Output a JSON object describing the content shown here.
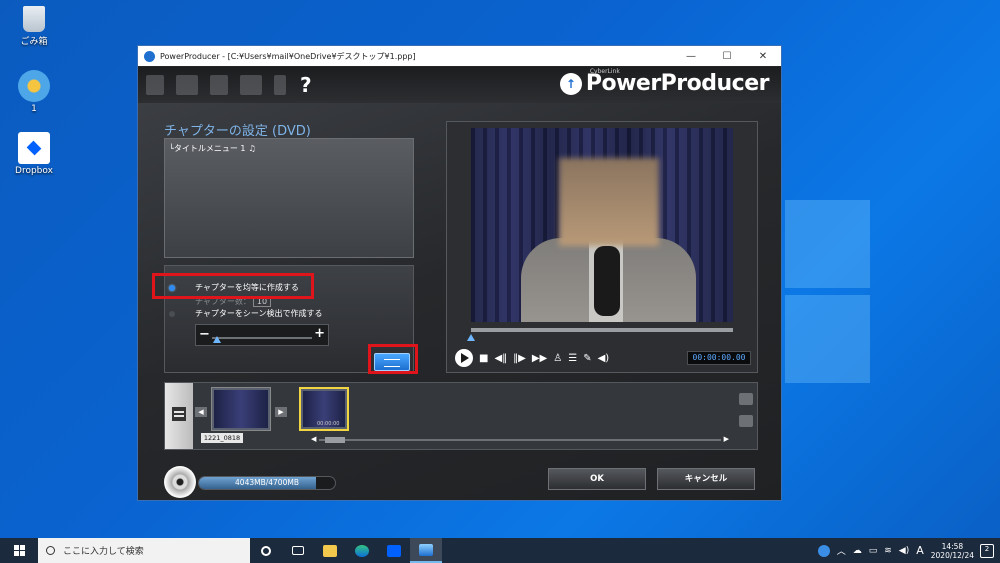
{
  "desktop": {
    "icons": [
      {
        "label": "ごみ箱",
        "icon": "recycle-bin-icon"
      },
      {
        "label": "1",
        "icon": "file-icon"
      },
      {
        "label": "Dropbox",
        "icon": "dropbox-icon"
      }
    ]
  },
  "window": {
    "title": "PowerProducer - [C:¥Users¥mail¥OneDrive¥デスクトップ¥1.ppp]",
    "controls": {
      "minimize": "—",
      "maximize": "☐",
      "close": "✕"
    }
  },
  "toolbar": {
    "icons": [
      "new-file-icon",
      "open-folder-icon",
      "save-icon",
      "burn-icon",
      "tools-icon"
    ],
    "help_label": "?",
    "brand_small": "CyberLink",
    "brand_name": "PowerProducer"
  },
  "chapter": {
    "section_title": "チャプターの設定 (DVD)",
    "menu_item": "└タイトルメニュー 1",
    "menu_note": "♫",
    "option_even": "チャプターを均等に作成する",
    "interval_label": "チャプター数：",
    "interval_value": "10",
    "option_scene": "チャプターをシーン検出で作成する",
    "slider_minus": "−",
    "slider_plus": "+",
    "slider_level": 0.05
  },
  "preview": {
    "timecode": "00:00:00.00",
    "seek_position": 0.0,
    "controls": [
      "play",
      "stop",
      "prev-frame",
      "next-frame",
      "fast-forward",
      "add-chapter",
      "chapter-list",
      "edit",
      "volume"
    ]
  },
  "timeline": {
    "clip_label": "1221_0818",
    "clip_time": "00:00:00",
    "scroll_left": "◀",
    "scroll_right": "▶"
  },
  "footer": {
    "capacity_text": "4043MB/4700MB",
    "capacity_fill": 0.86,
    "ok_label": "OK",
    "cancel_label": "キャンセル"
  },
  "taskbar": {
    "search_placeholder": "ここに入力して検索",
    "ime": "A",
    "time": "14:58",
    "date": "2020/12/24",
    "notif_count": "2"
  },
  "colors": {
    "accent": "#2f8bf0",
    "highlight": "#e0141b",
    "section_title": "#7fb4e8"
  }
}
